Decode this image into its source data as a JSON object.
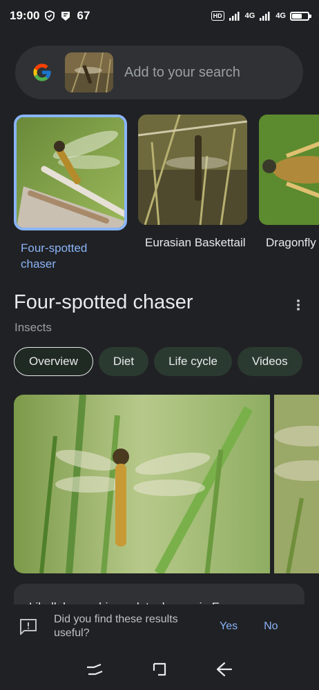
{
  "status_bar": {
    "time": "19:00",
    "notification_count": "67",
    "hd": "HD",
    "network1": "4G",
    "network2": "4G",
    "battery_level": 0.65
  },
  "search": {
    "placeholder": "Add to your search"
  },
  "related": [
    {
      "label": "Four-spotted chaser",
      "selected": true
    },
    {
      "label": "Eurasian Baskettail",
      "selected": false
    },
    {
      "label": "Dragonfly",
      "selected": false
    }
  ],
  "entity": {
    "title": "Four-spotted chaser",
    "subtitle": "Insects"
  },
  "tabs": [
    {
      "label": "Overview",
      "active": true
    },
    {
      "label": "Diet",
      "active": false
    },
    {
      "label": "Life cycle",
      "active": false
    },
    {
      "label": "Videos",
      "active": false
    }
  ],
  "description": {
    "text": "Libellula quadrimaculata, known in Europe as"
  },
  "feedback": {
    "question": "Did you find these results useful?",
    "yes": "Yes",
    "no": "No"
  },
  "colors": {
    "accent": "#8ab4f8",
    "background": "#202124",
    "surface": "#303134"
  }
}
